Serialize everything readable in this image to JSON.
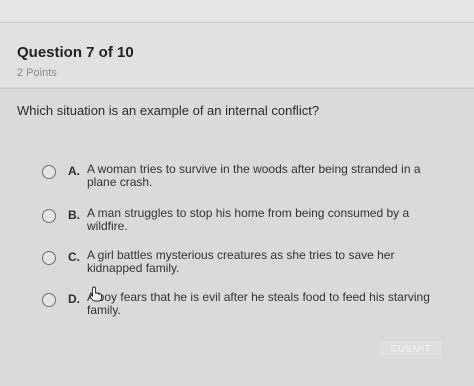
{
  "question": {
    "title": "Question 7 of 10",
    "points": "2 Points",
    "prompt": "Which situation is an example of an internal conflict?"
  },
  "options": [
    {
      "letter": "A.",
      "text": "A woman tries to survive in the woods after being stranded in a plane crash."
    },
    {
      "letter": "B.",
      "text": "A man struggles to stop his home from being consumed by a wildfire."
    },
    {
      "letter": "C.",
      "text": "A girl battles mysterious creatures as she tries to save her kidnapped family."
    },
    {
      "letter": "D.",
      "text": "A boy fears that he is evil after he steals food to feed his starving family."
    }
  ],
  "submit_label": "SUBMIT",
  "cursor_icon": "hand-pointer-icon"
}
